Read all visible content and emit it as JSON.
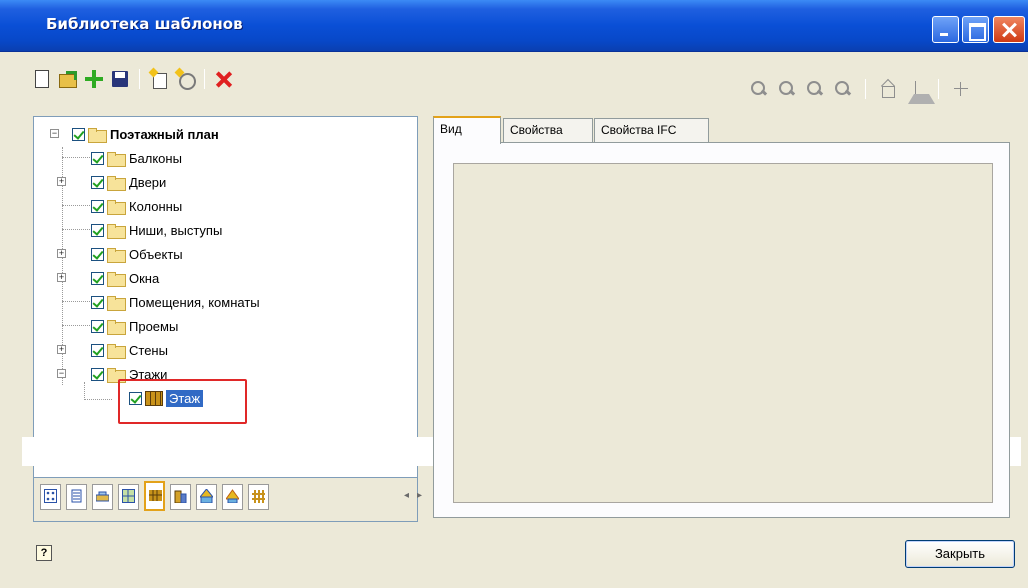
{
  "window": {
    "title": "Библиотека шаблонов"
  },
  "toolbar": {
    "left_icons": [
      "new-file-icon",
      "open-folder-icon",
      "add-icon",
      "save-icon",
      "new-template-icon",
      "new-object-icon",
      "delete-icon"
    ],
    "right_icons": [
      "zoom-region-icon",
      "zoom-in-icon",
      "zoom-out-icon",
      "zoom-extents-icon",
      "view-3d-icon",
      "mirror-icon",
      "center-icon"
    ]
  },
  "tree": {
    "root": {
      "label": "Поэтажный план",
      "checked": true,
      "expanded": true
    },
    "items": [
      {
        "label": "Балконы",
        "checked": true,
        "has_children": false
      },
      {
        "label": "Двери",
        "checked": true,
        "has_children": true
      },
      {
        "label": "Колонны",
        "checked": true,
        "has_children": false
      },
      {
        "label": "Ниши, выступы",
        "checked": true,
        "has_children": false
      },
      {
        "label": "Объекты",
        "checked": true,
        "has_children": true
      },
      {
        "label": "Окна",
        "checked": true,
        "has_children": true
      },
      {
        "label": "Помещения, комнаты",
        "checked": true,
        "has_children": false
      },
      {
        "label": "Проемы",
        "checked": true,
        "has_children": false
      },
      {
        "label": "Стены",
        "checked": true,
        "has_children": true
      },
      {
        "label": "Этажи",
        "checked": true,
        "has_children": true,
        "expanded": true
      }
    ],
    "selected_child": {
      "label": "Этаж",
      "checked": true,
      "icon": "floor-icon"
    }
  },
  "bottom_tabs": {
    "icons": [
      "grid-icon",
      "list-icon",
      "wall-icon",
      "plan-icon",
      "floor-icon",
      "building-icon",
      "stairs-icon",
      "roof-icon",
      "fence-icon"
    ],
    "active_index": 4
  },
  "right_tabs": [
    {
      "label": "Вид",
      "active": true
    },
    {
      "label": "Свойства",
      "active": false
    },
    {
      "label": "Свойства IFC",
      "active": false
    }
  ],
  "footer": {
    "help_label": "?",
    "close_label": "Закрыть"
  },
  "colors": {
    "selection": "#316ac5",
    "highlight_box": "#e02828",
    "checkmark": "#21a121",
    "titlebar": "#0a4fd6"
  }
}
